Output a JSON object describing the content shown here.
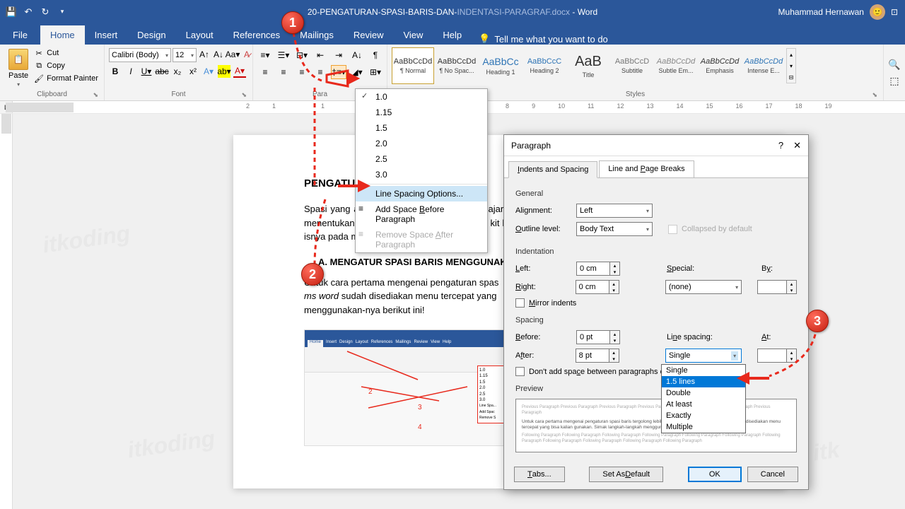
{
  "titlebar": {
    "doc_name": "20-PENGATURAN-SPASI-BARIS-DAN-",
    "doc_name_dim": "INDENTASI-PARAGRAF.docx",
    "app_suffix": "  -  Word",
    "user": "Muhammad Hernawan"
  },
  "tabs": {
    "file": "File",
    "home": "Home",
    "insert": "Insert",
    "design": "Design",
    "layout": "Layout",
    "references": "References",
    "mailings": "Mailings",
    "review": "Review",
    "view": "View",
    "help": "Help",
    "tellme": "Tell me what you want to do"
  },
  "ribbon": {
    "clipboard": {
      "paste": "Paste",
      "cut": "Cut",
      "copy": "Copy",
      "format_painter": "Format Painter",
      "label": "Clipboard"
    },
    "font": {
      "name": "Calibri (Body)",
      "size": "12",
      "label": "Font"
    },
    "paragraph": {
      "label": "Para"
    },
    "styles": {
      "label": "Styles",
      "items": [
        {
          "preview": "AaBbCcDd",
          "name": "¶ Normal"
        },
        {
          "preview": "AaBbCcDd",
          "name": "¶ No Spac..."
        },
        {
          "preview": "AaBbCc",
          "name": "Heading 1"
        },
        {
          "preview": "AaBbCcC",
          "name": "Heading 2"
        },
        {
          "preview": "AaB",
          "name": "Title"
        },
        {
          "preview": "AaBbCcD",
          "name": "Subtitle"
        },
        {
          "preview": "AaBbCcDd",
          "name": "Subtle Em..."
        },
        {
          "preview": "AaBbCcDd",
          "name": "Emphasis"
        },
        {
          "preview": "AaBbCcDd",
          "name": "Intense E..."
        }
      ]
    }
  },
  "ls_menu": {
    "v10": "1.0",
    "v115": "1.15",
    "v15": "1.5",
    "v20": "2.0",
    "v25": "2.5",
    "v30": "3.0",
    "options": "Line Spacing Options...",
    "add_before": "Add Space Before Paragraph",
    "remove_after": "Remove Space After Paragraph"
  },
  "dialog": {
    "title": "Paragraph",
    "tab1": "Indents and Spacing",
    "tab2": "Line and Page Breaks",
    "general": "General",
    "alignment_label": "Alignment:",
    "alignment_value": "Left",
    "outline_label": "Outline level:",
    "outline_value": "Body Text",
    "collapsed": "Collapsed by default",
    "indentation": "Indentation",
    "left_label": "Left:",
    "left_value": "0 cm",
    "right_label": "Right:",
    "right_value": "0 cm",
    "special_label": "Special:",
    "special_value": "(none)",
    "by_label": "By:",
    "mirror": "Mirror indents",
    "spacing": "Spacing",
    "before_label": "Before:",
    "before_value": "0 pt",
    "after_label": "After:",
    "after_value": "8 pt",
    "linespacing_label": "Line spacing:",
    "linespacing_value": "Single",
    "at_label": "At:",
    "dont_add": "Don't add space between paragraphs of",
    "preview": "Preview",
    "tabs_btn": "Tabs...",
    "default_btn": "Set As Default",
    "ok_btn": "OK",
    "cancel_btn": "Cancel",
    "ls_options": [
      "Single",
      "1.5 lines",
      "Double",
      "At least",
      "Exactly",
      "Multiple"
    ]
  },
  "document": {
    "heading": "PENGATURA                      I PA",
    "para1": "Spasi yang akan kita bahas pada materi belajar l                                                         spacing yang berada di pengaturan paragraf. Fu                                                          menentukan jarak antar baris pada dokumen kit                                                          kata melainkan jarak antar baris. Jika anda menc                                                          m         isnya pada materi sebelumnya tentang ca",
    "subhead": "A.   MENGATUR SPASI BARIS MENGGUNAK",
    "para2_a": "Untuk cara pertama mengenai pengaturan spas",
    "para2_b": "ms word",
    "para2_c": " sudah disediakan menu tercepat yang ",
    "para2_d": "menggunakan-nya berikut ini!"
  },
  "preview_text": {
    "gray1": "Previous Paragraph Previous Paragraph Previous Paragraph Previous Paragraph Previous Paragraph Previous Paragraph Previous Paragraph",
    "dark": "Untuk cara pertama mengenai pengaturan spasi baris tergolong lebih mudah karena di dalam ms word sudah disediakan menu tercepat yang bisa kalian gunakan. Simak langkah-langkah menggunakan-nya berikut ini!",
    "gray2": "Following Paragraph Following Paragraph Following Paragraph Following Paragraph Following Paragraph Following Paragraph Following Paragraph Following Paragraph Following Paragraph Following Paragraph Following Paragraph"
  }
}
